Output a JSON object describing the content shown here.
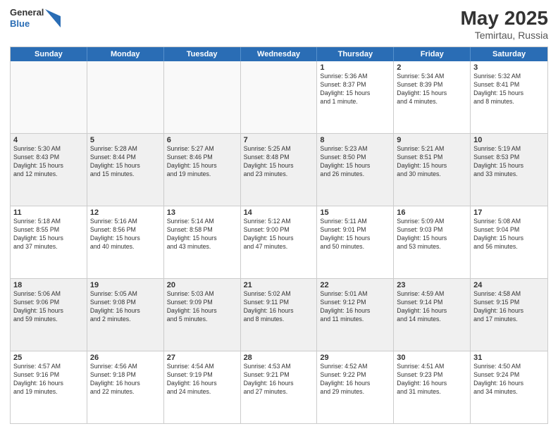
{
  "header": {
    "logo_general": "General",
    "logo_blue": "Blue",
    "title": "May 2025",
    "location": "Temirtau, Russia"
  },
  "weekdays": [
    "Sunday",
    "Monday",
    "Tuesday",
    "Wednesday",
    "Thursday",
    "Friday",
    "Saturday"
  ],
  "rows": [
    [
      {
        "day": "",
        "info": "",
        "empty": true
      },
      {
        "day": "",
        "info": "",
        "empty": true
      },
      {
        "day": "",
        "info": "",
        "empty": true
      },
      {
        "day": "",
        "info": "",
        "empty": true
      },
      {
        "day": "1",
        "info": "Sunrise: 5:36 AM\nSunset: 8:37 PM\nDaylight: 15 hours\nand 1 minute."
      },
      {
        "day": "2",
        "info": "Sunrise: 5:34 AM\nSunset: 8:39 PM\nDaylight: 15 hours\nand 4 minutes."
      },
      {
        "day": "3",
        "info": "Sunrise: 5:32 AM\nSunset: 8:41 PM\nDaylight: 15 hours\nand 8 minutes."
      }
    ],
    [
      {
        "day": "4",
        "info": "Sunrise: 5:30 AM\nSunset: 8:43 PM\nDaylight: 15 hours\nand 12 minutes.",
        "shaded": true
      },
      {
        "day": "5",
        "info": "Sunrise: 5:28 AM\nSunset: 8:44 PM\nDaylight: 15 hours\nand 15 minutes.",
        "shaded": true
      },
      {
        "day": "6",
        "info": "Sunrise: 5:27 AM\nSunset: 8:46 PM\nDaylight: 15 hours\nand 19 minutes.",
        "shaded": true
      },
      {
        "day": "7",
        "info": "Sunrise: 5:25 AM\nSunset: 8:48 PM\nDaylight: 15 hours\nand 23 minutes.",
        "shaded": true
      },
      {
        "day": "8",
        "info": "Sunrise: 5:23 AM\nSunset: 8:50 PM\nDaylight: 15 hours\nand 26 minutes.",
        "shaded": true
      },
      {
        "day": "9",
        "info": "Sunrise: 5:21 AM\nSunset: 8:51 PM\nDaylight: 15 hours\nand 30 minutes.",
        "shaded": true
      },
      {
        "day": "10",
        "info": "Sunrise: 5:19 AM\nSunset: 8:53 PM\nDaylight: 15 hours\nand 33 minutes.",
        "shaded": true
      }
    ],
    [
      {
        "day": "11",
        "info": "Sunrise: 5:18 AM\nSunset: 8:55 PM\nDaylight: 15 hours\nand 37 minutes."
      },
      {
        "day": "12",
        "info": "Sunrise: 5:16 AM\nSunset: 8:56 PM\nDaylight: 15 hours\nand 40 minutes."
      },
      {
        "day": "13",
        "info": "Sunrise: 5:14 AM\nSunset: 8:58 PM\nDaylight: 15 hours\nand 43 minutes."
      },
      {
        "day": "14",
        "info": "Sunrise: 5:12 AM\nSunset: 9:00 PM\nDaylight: 15 hours\nand 47 minutes."
      },
      {
        "day": "15",
        "info": "Sunrise: 5:11 AM\nSunset: 9:01 PM\nDaylight: 15 hours\nand 50 minutes."
      },
      {
        "day": "16",
        "info": "Sunrise: 5:09 AM\nSunset: 9:03 PM\nDaylight: 15 hours\nand 53 minutes."
      },
      {
        "day": "17",
        "info": "Sunrise: 5:08 AM\nSunset: 9:04 PM\nDaylight: 15 hours\nand 56 minutes."
      }
    ],
    [
      {
        "day": "18",
        "info": "Sunrise: 5:06 AM\nSunset: 9:06 PM\nDaylight: 15 hours\nand 59 minutes.",
        "shaded": true
      },
      {
        "day": "19",
        "info": "Sunrise: 5:05 AM\nSunset: 9:08 PM\nDaylight: 16 hours\nand 2 minutes.",
        "shaded": true
      },
      {
        "day": "20",
        "info": "Sunrise: 5:03 AM\nSunset: 9:09 PM\nDaylight: 16 hours\nand 5 minutes.",
        "shaded": true
      },
      {
        "day": "21",
        "info": "Sunrise: 5:02 AM\nSunset: 9:11 PM\nDaylight: 16 hours\nand 8 minutes.",
        "shaded": true
      },
      {
        "day": "22",
        "info": "Sunrise: 5:01 AM\nSunset: 9:12 PM\nDaylight: 16 hours\nand 11 minutes.",
        "shaded": true
      },
      {
        "day": "23",
        "info": "Sunrise: 4:59 AM\nSunset: 9:14 PM\nDaylight: 16 hours\nand 14 minutes.",
        "shaded": true
      },
      {
        "day": "24",
        "info": "Sunrise: 4:58 AM\nSunset: 9:15 PM\nDaylight: 16 hours\nand 17 minutes.",
        "shaded": true
      }
    ],
    [
      {
        "day": "25",
        "info": "Sunrise: 4:57 AM\nSunset: 9:16 PM\nDaylight: 16 hours\nand 19 minutes."
      },
      {
        "day": "26",
        "info": "Sunrise: 4:56 AM\nSunset: 9:18 PM\nDaylight: 16 hours\nand 22 minutes."
      },
      {
        "day": "27",
        "info": "Sunrise: 4:54 AM\nSunset: 9:19 PM\nDaylight: 16 hours\nand 24 minutes."
      },
      {
        "day": "28",
        "info": "Sunrise: 4:53 AM\nSunset: 9:21 PM\nDaylight: 16 hours\nand 27 minutes."
      },
      {
        "day": "29",
        "info": "Sunrise: 4:52 AM\nSunset: 9:22 PM\nDaylight: 16 hours\nand 29 minutes."
      },
      {
        "day": "30",
        "info": "Sunrise: 4:51 AM\nSunset: 9:23 PM\nDaylight: 16 hours\nand 31 minutes."
      },
      {
        "day": "31",
        "info": "Sunrise: 4:50 AM\nSunset: 9:24 PM\nDaylight: 16 hours\nand 34 minutes."
      }
    ]
  ]
}
